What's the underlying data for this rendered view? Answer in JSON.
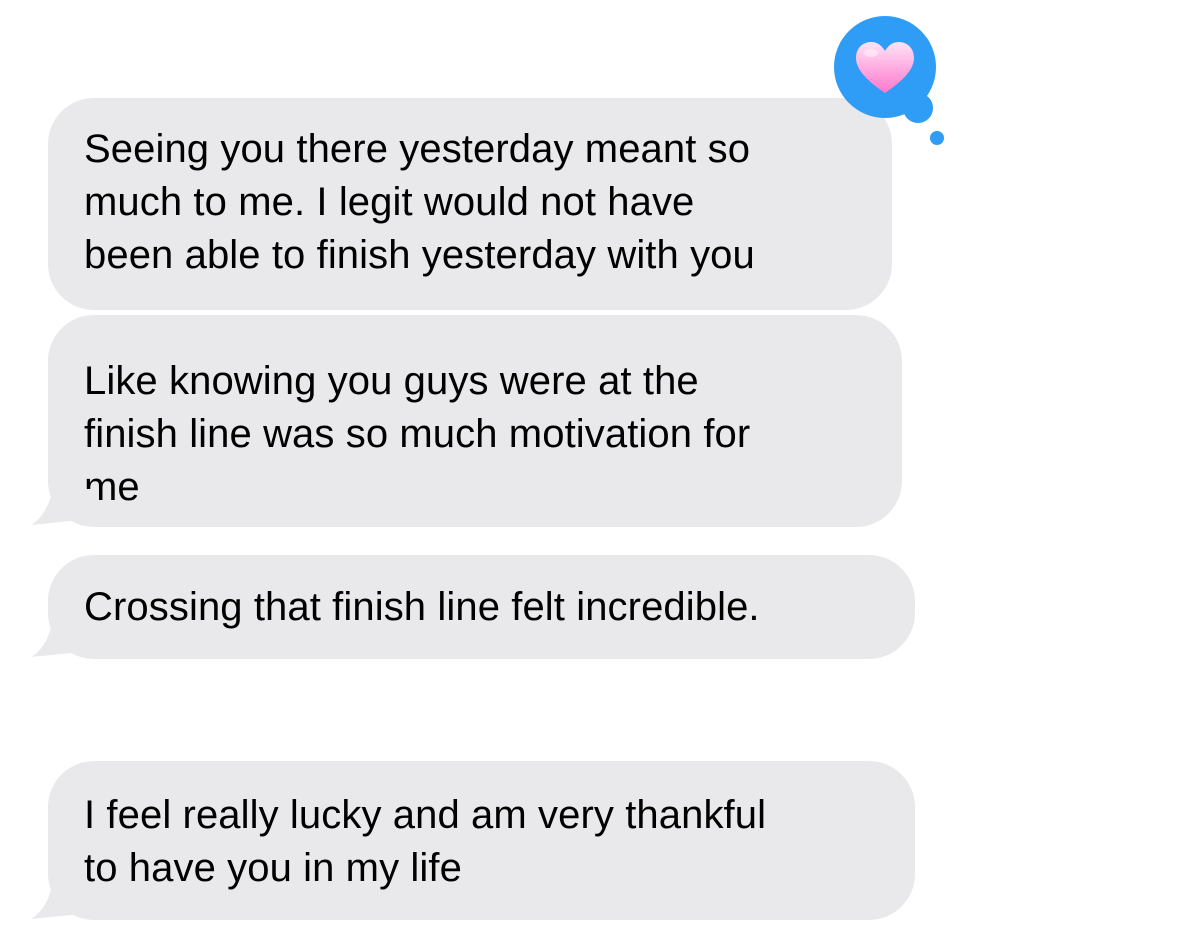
{
  "messages": [
    {
      "id": "b1",
      "direction": "incoming",
      "text": "Seeing you there yesterday meant so\nmuch to me. I legit would not have\nbeen able to finish yesterday with you",
      "reaction": "heart-icon"
    },
    {
      "id": "b2",
      "direction": "incoming",
      "text": "Like knowing you guys were at the\nfinish line was so much motivation for\nme"
    },
    {
      "id": "b3",
      "direction": "incoming",
      "text": "Crossing that finish line felt incredible."
    },
    {
      "id": "b4",
      "direction": "incoming",
      "text": "I feel really lucky and am very thankful\nto have you in my life"
    }
  ],
  "colors": {
    "incoming_bubble": "#e9e9eb",
    "incoming_text": "#000000",
    "reaction_bubble": "#2f9cf5",
    "heart_light": "#ffd2f0",
    "heart_dark": "#ff7fcf"
  },
  "icons": {
    "reaction": "heart-icon"
  }
}
